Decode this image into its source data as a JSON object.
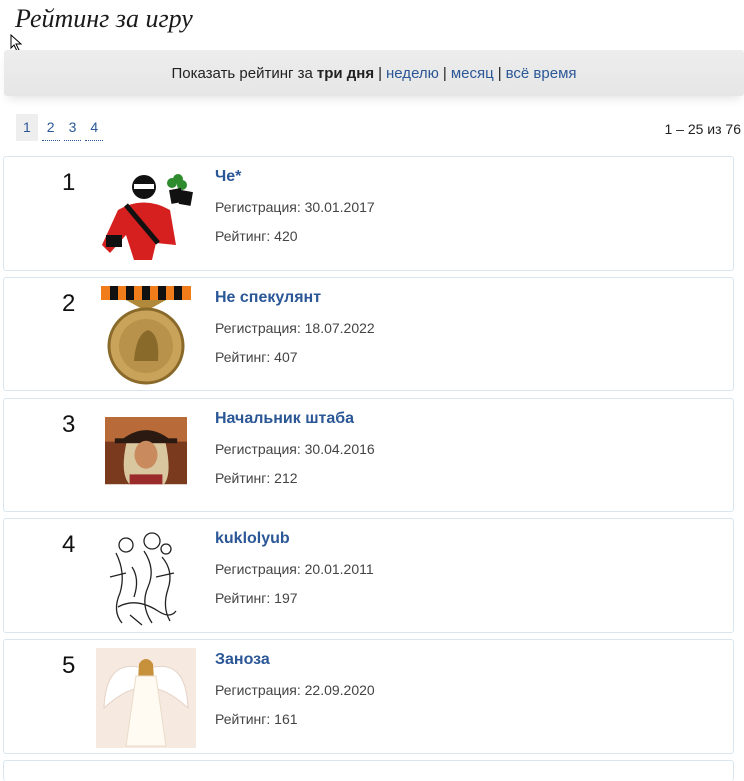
{
  "page": {
    "title": "Рейтинг за игру"
  },
  "filter": {
    "prefix": "Показать рейтинг за",
    "active": "три дня",
    "options": [
      "неделю",
      "месяц",
      "всё время"
    ],
    "separator": "|"
  },
  "pager": {
    "pages": [
      "1",
      "2",
      "3",
      "4"
    ],
    "current": "1",
    "range": "1 – 25 из 76"
  },
  "players": [
    {
      "rank": "1",
      "name": "Че*",
      "registration": "Регистрация: 30.01.2017",
      "rating": "Рейтинг: 420"
    },
    {
      "rank": "2",
      "name": "Не спекулянт",
      "registration": "Регистрация: 18.07.2022",
      "rating": "Рейтинг: 407"
    },
    {
      "rank": "3",
      "name": "Начальник штаба",
      "registration": "Регистрация: 30.04.2016",
      "rating": "Рейтинг: 212"
    },
    {
      "rank": "4",
      "name": "kuklolyub",
      "registration": "Регистрация: 20.01.2011",
      "rating": "Рейтинг: 197"
    },
    {
      "rank": "5",
      "name": "Заноза",
      "registration": "Регистрация: 22.09.2020",
      "rating": "Рейтинг: 161"
    }
  ],
  "colors": {
    "link": "#2b5797",
    "filter_bg": "#ececec",
    "card_border": "#d9e6ef"
  }
}
